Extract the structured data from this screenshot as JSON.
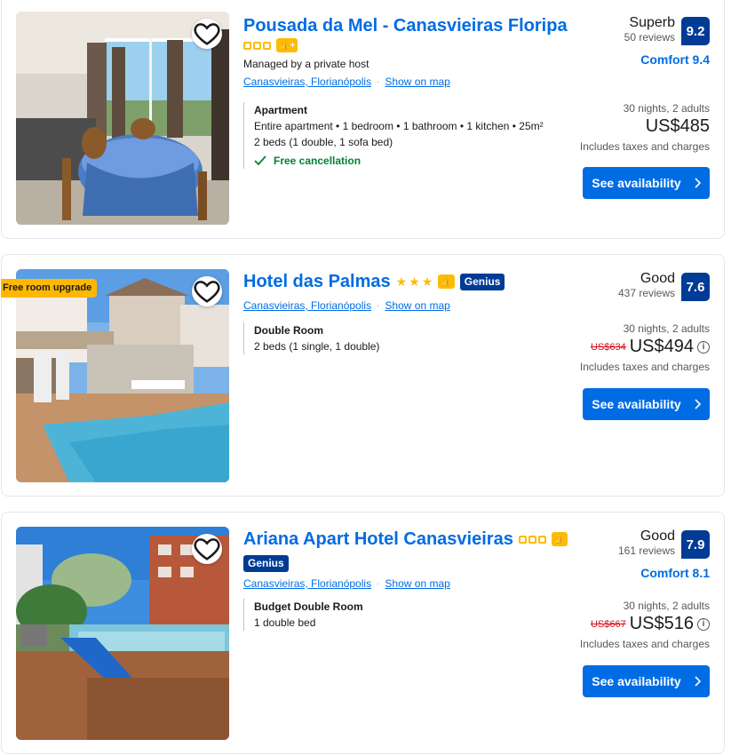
{
  "listings": [
    {
      "name": "Pousada da Mel - Canasvieiras Floripa",
      "managed": "Managed by a private host",
      "location": "Canasvieiras, Florianópolis",
      "map_link": "Show on map",
      "room_type": "Apartment",
      "room_desc": "Entire apartment • 1 bedroom • 1 bathroom • 1 kitchen • 25m²",
      "beds": "2 beds (1 double, 1 sofa bed)",
      "cancellation": "Free cancellation",
      "score_word": "Superb",
      "reviews": "50 reviews",
      "score": "9.2",
      "comfort": "Comfort 9.4",
      "stay": "30 nights, 2 adults",
      "price": "US$485",
      "taxes": "Includes taxes and charges",
      "button": "See availability"
    },
    {
      "name": "Hotel das Palmas",
      "badge": "Free room upgrade",
      "genius": "Genius",
      "location": "Canasvieiras, Florianópolis",
      "map_link": "Show on map",
      "room_type": "Double Room",
      "beds": "2 beds (1 single, 1 double)",
      "score_word": "Good",
      "reviews": "437 reviews",
      "score": "7.6",
      "stay": "30 nights, 2 adults",
      "old_price": "US$634",
      "price": "US$494",
      "taxes": "Includes taxes and charges",
      "button": "See availability"
    },
    {
      "name": "Ariana Apart Hotel Canasvieiras",
      "genius": "Genius",
      "location": "Canasvieiras, Florianópolis",
      "map_link": "Show on map",
      "room_type": "Budget Double Room",
      "beds": "1 double bed",
      "score_word": "Good",
      "reviews": "161 reviews",
      "score": "7.9",
      "comfort": "Comfort 8.1",
      "stay": "30 nights, 2 adults",
      "old_price": "US$667",
      "price": "US$516",
      "taxes": "Includes taxes and charges",
      "button": "See availability"
    }
  ],
  "colors": {
    "brand_blue": "#006ce4",
    "score_blue": "#003b95",
    "star_yellow": "#febb02",
    "green": "#008234",
    "red": "#d4111e"
  },
  "icons": {
    "favorite": "heart-icon",
    "info": "info-icon",
    "arrow": "chevron-right-icon",
    "check": "check-icon",
    "thumb": "thumbs-up-icon"
  }
}
